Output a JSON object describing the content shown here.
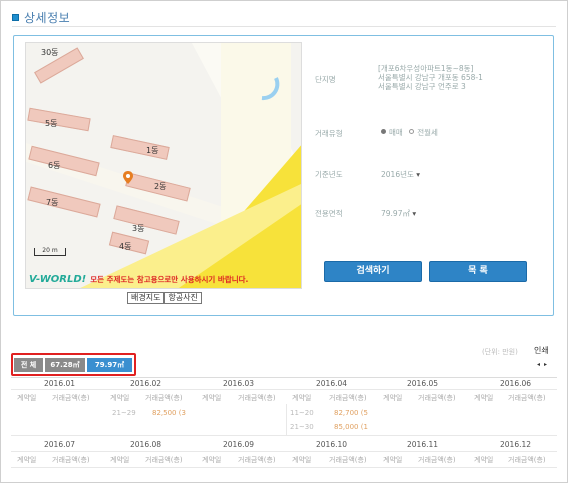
{
  "section": {
    "title": "상세정보"
  },
  "map": {
    "buildings": [
      "30동",
      "5동",
      "1동",
      "6동",
      "2동",
      "7동",
      "3동",
      "4동"
    ],
    "scale_label": "20 m",
    "logo_text": "V-WORLD!",
    "notice": "모든 주제도는 참고용으로만 사용하시기 바랍니다.",
    "tabs": [
      "배경지도",
      "항공사진"
    ]
  },
  "info": {
    "complex_label": "단지명",
    "complex_lines": [
      "[개포6차우성아파트1동~8동]",
      "서울특별시 강남구 개포동 658-1",
      "서울특별시 강남구 언주로 3"
    ],
    "trade_type_label": "거래유형",
    "trade_options": [
      "매매",
      "전월세"
    ],
    "trade_selected": "매매",
    "base_year_label": "기준년도",
    "base_year_value": "2016년도",
    "area_label": "전용면적",
    "area_value": "79.97㎡"
  },
  "buttons": {
    "search": "검색하기",
    "list": "목 록"
  },
  "table": {
    "unit_note": "(단위: 만원)",
    "print_label": "인쇄",
    "area_tabs": [
      "전 체",
      "67.28㎡",
      "79.97㎡"
    ],
    "area_tab_selected": "79.97㎡",
    "col_headers": [
      "계약일",
      "거래금액(층)"
    ],
    "months_row1": [
      "2016.01",
      "2016.02",
      "2016.03",
      "2016.04",
      "2016.05",
      "2016.06"
    ],
    "months_row2": [
      "2016.07",
      "2016.08",
      "2016.09",
      "2016.10",
      "2016.11",
      "2016.12"
    ],
    "feb_entries": [
      {
        "date": "21~29",
        "price": "82,500 (3"
      }
    ],
    "apr_entries": [
      {
        "date": "11~20",
        "price": "82,700 (5"
      },
      {
        "date": "21~30",
        "price": "85,000 (1"
      }
    ]
  },
  "colors": {
    "accent": "#2e84c6",
    "tab_all": "#8a8a8a",
    "tab_other": "#8a8a8a",
    "tab_selected": "#3a8fd0",
    "highlight_border": "#e02020",
    "building": "#f0c9bd",
    "park": "#f7e23a"
  }
}
